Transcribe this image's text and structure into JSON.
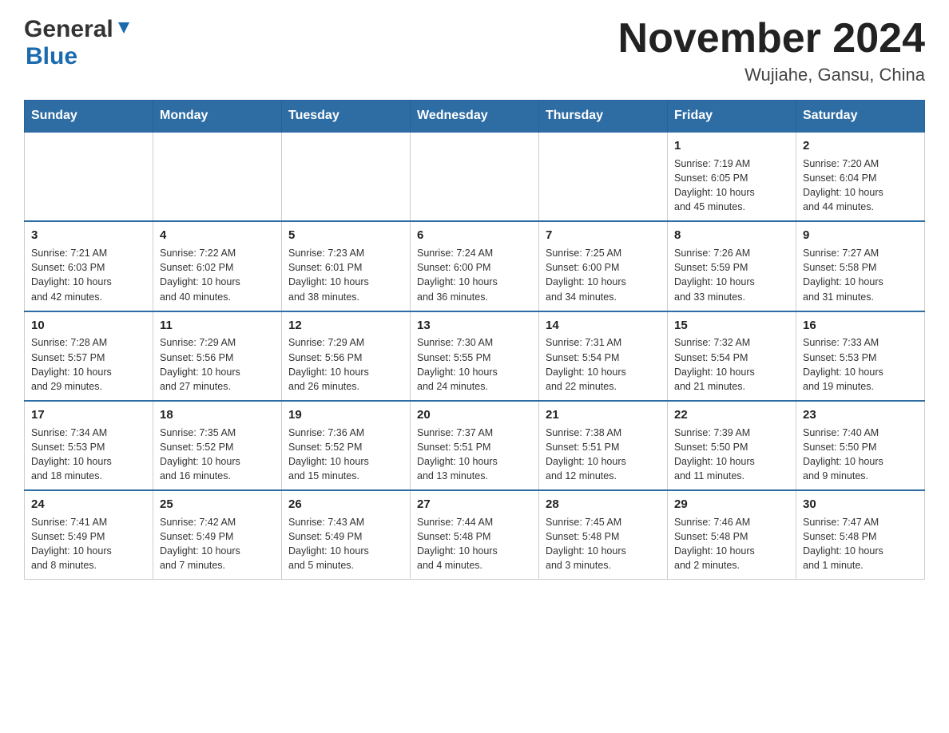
{
  "header": {
    "logo_general": "General",
    "logo_blue": "Blue",
    "month_title": "November 2024",
    "location": "Wujiahe, Gansu, China"
  },
  "days_of_week": [
    "Sunday",
    "Monday",
    "Tuesday",
    "Wednesday",
    "Thursday",
    "Friday",
    "Saturday"
  ],
  "weeks": [
    [
      {
        "day": "",
        "info": ""
      },
      {
        "day": "",
        "info": ""
      },
      {
        "day": "",
        "info": ""
      },
      {
        "day": "",
        "info": ""
      },
      {
        "day": "",
        "info": ""
      },
      {
        "day": "1",
        "info": "Sunrise: 7:19 AM\nSunset: 6:05 PM\nDaylight: 10 hours\nand 45 minutes."
      },
      {
        "day": "2",
        "info": "Sunrise: 7:20 AM\nSunset: 6:04 PM\nDaylight: 10 hours\nand 44 minutes."
      }
    ],
    [
      {
        "day": "3",
        "info": "Sunrise: 7:21 AM\nSunset: 6:03 PM\nDaylight: 10 hours\nand 42 minutes."
      },
      {
        "day": "4",
        "info": "Sunrise: 7:22 AM\nSunset: 6:02 PM\nDaylight: 10 hours\nand 40 minutes."
      },
      {
        "day": "5",
        "info": "Sunrise: 7:23 AM\nSunset: 6:01 PM\nDaylight: 10 hours\nand 38 minutes."
      },
      {
        "day": "6",
        "info": "Sunrise: 7:24 AM\nSunset: 6:00 PM\nDaylight: 10 hours\nand 36 minutes."
      },
      {
        "day": "7",
        "info": "Sunrise: 7:25 AM\nSunset: 6:00 PM\nDaylight: 10 hours\nand 34 minutes."
      },
      {
        "day": "8",
        "info": "Sunrise: 7:26 AM\nSunset: 5:59 PM\nDaylight: 10 hours\nand 33 minutes."
      },
      {
        "day": "9",
        "info": "Sunrise: 7:27 AM\nSunset: 5:58 PM\nDaylight: 10 hours\nand 31 minutes."
      }
    ],
    [
      {
        "day": "10",
        "info": "Sunrise: 7:28 AM\nSunset: 5:57 PM\nDaylight: 10 hours\nand 29 minutes."
      },
      {
        "day": "11",
        "info": "Sunrise: 7:29 AM\nSunset: 5:56 PM\nDaylight: 10 hours\nand 27 minutes."
      },
      {
        "day": "12",
        "info": "Sunrise: 7:29 AM\nSunset: 5:56 PM\nDaylight: 10 hours\nand 26 minutes."
      },
      {
        "day": "13",
        "info": "Sunrise: 7:30 AM\nSunset: 5:55 PM\nDaylight: 10 hours\nand 24 minutes."
      },
      {
        "day": "14",
        "info": "Sunrise: 7:31 AM\nSunset: 5:54 PM\nDaylight: 10 hours\nand 22 minutes."
      },
      {
        "day": "15",
        "info": "Sunrise: 7:32 AM\nSunset: 5:54 PM\nDaylight: 10 hours\nand 21 minutes."
      },
      {
        "day": "16",
        "info": "Sunrise: 7:33 AM\nSunset: 5:53 PM\nDaylight: 10 hours\nand 19 minutes."
      }
    ],
    [
      {
        "day": "17",
        "info": "Sunrise: 7:34 AM\nSunset: 5:53 PM\nDaylight: 10 hours\nand 18 minutes."
      },
      {
        "day": "18",
        "info": "Sunrise: 7:35 AM\nSunset: 5:52 PM\nDaylight: 10 hours\nand 16 minutes."
      },
      {
        "day": "19",
        "info": "Sunrise: 7:36 AM\nSunset: 5:52 PM\nDaylight: 10 hours\nand 15 minutes."
      },
      {
        "day": "20",
        "info": "Sunrise: 7:37 AM\nSunset: 5:51 PM\nDaylight: 10 hours\nand 13 minutes."
      },
      {
        "day": "21",
        "info": "Sunrise: 7:38 AM\nSunset: 5:51 PM\nDaylight: 10 hours\nand 12 minutes."
      },
      {
        "day": "22",
        "info": "Sunrise: 7:39 AM\nSunset: 5:50 PM\nDaylight: 10 hours\nand 11 minutes."
      },
      {
        "day": "23",
        "info": "Sunrise: 7:40 AM\nSunset: 5:50 PM\nDaylight: 10 hours\nand 9 minutes."
      }
    ],
    [
      {
        "day": "24",
        "info": "Sunrise: 7:41 AM\nSunset: 5:49 PM\nDaylight: 10 hours\nand 8 minutes."
      },
      {
        "day": "25",
        "info": "Sunrise: 7:42 AM\nSunset: 5:49 PM\nDaylight: 10 hours\nand 7 minutes."
      },
      {
        "day": "26",
        "info": "Sunrise: 7:43 AM\nSunset: 5:49 PM\nDaylight: 10 hours\nand 5 minutes."
      },
      {
        "day": "27",
        "info": "Sunrise: 7:44 AM\nSunset: 5:48 PM\nDaylight: 10 hours\nand 4 minutes."
      },
      {
        "day": "28",
        "info": "Sunrise: 7:45 AM\nSunset: 5:48 PM\nDaylight: 10 hours\nand 3 minutes."
      },
      {
        "day": "29",
        "info": "Sunrise: 7:46 AM\nSunset: 5:48 PM\nDaylight: 10 hours\nand 2 minutes."
      },
      {
        "day": "30",
        "info": "Sunrise: 7:47 AM\nSunset: 5:48 PM\nDaylight: 10 hours\nand 1 minute."
      }
    ]
  ]
}
